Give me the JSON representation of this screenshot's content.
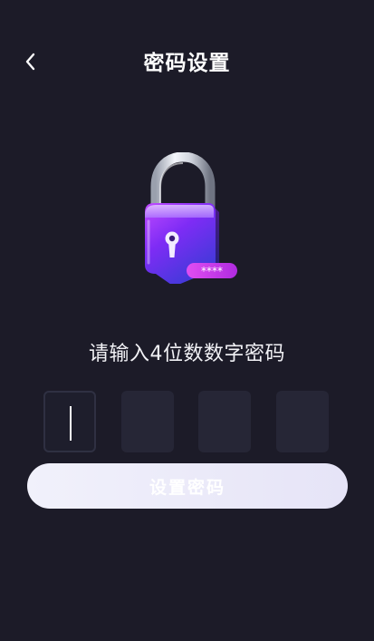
{
  "header": {
    "back_icon": "chevron-left-icon",
    "title": "密码设置"
  },
  "illustration": {
    "icon": "padlock-icon",
    "badge_text": "****"
  },
  "prompt": "请输入4位数数字密码",
  "pin": {
    "length": 4,
    "active_index": 0,
    "values": [
      "",
      "",
      "",
      ""
    ]
  },
  "submit_label": "设置密码",
  "colors": {
    "background": "#1c1b28",
    "pin_box": "#262636",
    "button": "#eceaf9",
    "lock_purple": "#8f32ff",
    "badge_pink": "#d93aea"
  }
}
